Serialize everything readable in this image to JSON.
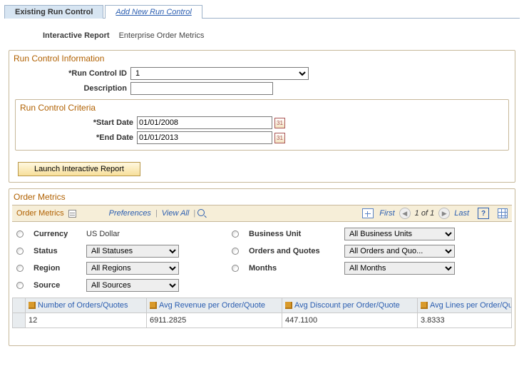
{
  "tabs": {
    "existing": "Existing Run Control",
    "addnew": "Add New Run Control"
  },
  "report": {
    "label": "Interactive Report",
    "value": "Enterprise Order Metrics"
  },
  "runControlInfo": {
    "title": "Run Control Information",
    "idLabel": "*Run Control ID",
    "idValue": "1",
    "descLabel": "Description",
    "descValue": ""
  },
  "criteria": {
    "title": "Run Control Criteria",
    "startLabel": "*Start Date",
    "startValue": "01/01/2008",
    "endLabel": "*End Date",
    "endValue": "01/01/2013"
  },
  "launchLabel": "Launch Interactive Report",
  "metrics": {
    "panelTitle": "Order Metrics",
    "gridTitle": "Order Metrics",
    "preferences": "Preferences",
    "viewAll": "View All",
    "first": "First",
    "pager": "1 of 1",
    "last": "Last"
  },
  "filters": {
    "currencyLabel": "Currency",
    "currencyValue": "US Dollar",
    "buLabel": "Business Unit",
    "buValue": "All Business Units",
    "statusLabel": "Status",
    "statusValue": "All Statuses",
    "oqLabel": "Orders and Quotes",
    "oqValue": "All Orders and Quo...",
    "regionLabel": "Region",
    "regionValue": "All Regions",
    "monthsLabel": "Months",
    "monthsValue": "All Months",
    "sourceLabel": "Source",
    "sourceValue": "All Sources"
  },
  "table": {
    "col1": "Number of Orders/Quotes",
    "col2": "Avg Revenue per Order/Quote",
    "col3": "Avg Discount per Order/Quote",
    "col4": "Avg Lines per Order/Qu",
    "row1": {
      "c1": "12",
      "c2": "6911.2825",
      "c3": "447.1100",
      "c4": "3.8333"
    }
  }
}
